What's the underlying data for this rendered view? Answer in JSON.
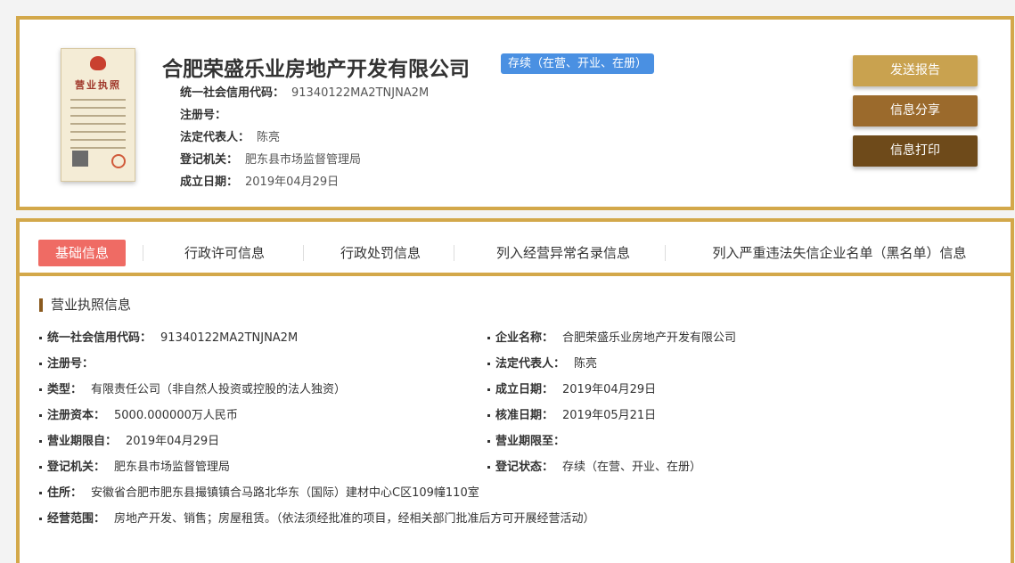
{
  "header": {
    "company_name": "合肥荣盛乐业房地产开发有限公司",
    "status_badge": "存续（在营、开业、在册）",
    "rows": [
      {
        "label": "统一社会信用代码：",
        "value": "91340122MA2TNJNA2M"
      },
      {
        "label": "注册号：",
        "value": ""
      },
      {
        "label": "法定代表人：",
        "value": "陈亮"
      },
      {
        "label": "登记机关：",
        "value": "肥东县市场监督管理局"
      },
      {
        "label": "成立日期：",
        "value": "2019年04月29日"
      }
    ],
    "license_image_text": "营业执照",
    "buttons": {
      "send": "发送报告",
      "share": "信息分享",
      "print": "信息打印"
    }
  },
  "tabs": [
    {
      "label": "基础信息",
      "active": true
    },
    {
      "label": "行政许可信息",
      "active": false
    },
    {
      "label": "行政处罚信息",
      "active": false
    },
    {
      "label": "列入经营异常名录信息",
      "active": false
    },
    {
      "label": "列入严重违法失信企业名单（黑名单）信息",
      "active": false
    }
  ],
  "section": {
    "title": "营业执照信息",
    "fields": {
      "credit_code": {
        "label": "统一社会信用代码：",
        "value": "91340122MA2TNJNA2M"
      },
      "company_name": {
        "label": "企业名称：",
        "value": "合肥荣盛乐业房地产开发有限公司"
      },
      "reg_no": {
        "label": "注册号：",
        "value": ""
      },
      "legal_rep": {
        "label": "法定代表人：",
        "value": "陈亮"
      },
      "type": {
        "label": "类型：",
        "value": "有限责任公司（非自然人投资或控股的法人独资）"
      },
      "established": {
        "label": "成立日期：",
        "value": "2019年04月29日"
      },
      "capital": {
        "label": "注册资本：",
        "value": "5000.000000万人民币"
      },
      "approved": {
        "label": "核准日期：",
        "value": "2019年05月21日"
      },
      "term_from": {
        "label": "营业期限自：",
        "value": "2019年04月29日"
      },
      "term_to": {
        "label": "营业期限至：",
        "value": ""
      },
      "authority": {
        "label": "登记机关：",
        "value": "肥东县市场监督管理局"
      },
      "reg_status": {
        "label": "登记状态：",
        "value": "存续（在营、开业、在册）"
      },
      "address": {
        "label": "住所：",
        "value": "安徽省合肥市肥东县撮镇镇合马路北华东（国际）建材中心C区109幢110室"
      },
      "scope": {
        "label": "经营范围：",
        "value": "房地产开发、销售；房屋租赁。（依法须经批准的项目，经相关部门批准后方可开展经营活动）"
      }
    }
  },
  "colors": {
    "border_gold": "#d3a84a",
    "active_tab": "#ef6b64",
    "badge_blue": "#4a90e2",
    "btn_send": "#c9a24f",
    "btn_share": "#9b6a2c",
    "btn_print": "#6e4a1a"
  }
}
